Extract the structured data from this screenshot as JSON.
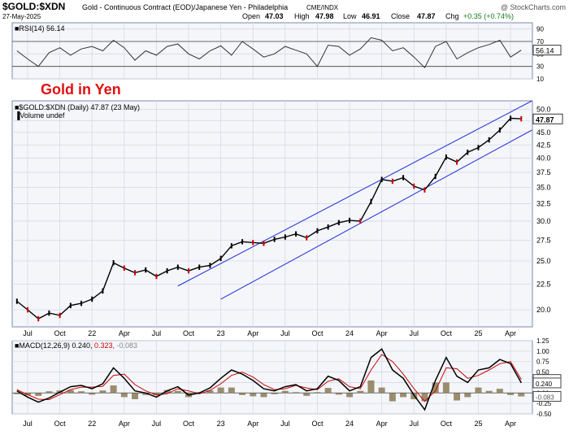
{
  "header": {
    "symbol": "$GOLD:$XDN",
    "description": "Gold - Continuous Contract (EOD)/Japanese Yen - Philadelphia",
    "exchange": "CME/INDX",
    "date": "27-May-2025",
    "copyright": "@ StockCharts.com",
    "ohlc": {
      "open_label": "Open",
      "open": "47.03",
      "high_label": "High",
      "high": "47.98",
      "low_label": "Low",
      "low": "46.91",
      "close_label": "Close",
      "close": "47.87",
      "chg_label": "Chg",
      "chg": "+0.35 (+0.74%)"
    }
  },
  "annotation": "Gold in Yen",
  "colors": {
    "price_up": "#000000",
    "price_down": "#cc0000",
    "channel": "#1f2bd6",
    "macd": "#000000",
    "signal": "#cc0000",
    "histogram": "#8a7a55",
    "annotation": "#e01010",
    "grid": "#d4d9e4",
    "panel_bg": "#f4f6fa"
  },
  "chart_data": [
    {
      "type": "line",
      "panel": "rsi",
      "label": "RSI(14)",
      "last_value": "56.14",
      "ylim": [
        10,
        100
      ],
      "y_ticks": [
        "90",
        "70",
        "50",
        "30",
        "10"
      ],
      "reference_lines": [
        70,
        30
      ],
      "x": [
        "2021-06",
        "2021-07",
        "2021-08",
        "2021-09",
        "2021-10",
        "2021-11",
        "2021-12",
        "2022-01",
        "2022-02",
        "2022-03",
        "2022-04",
        "2022-05",
        "2022-06",
        "2022-07",
        "2022-08",
        "2022-09",
        "2022-10",
        "2022-11",
        "2022-12",
        "2023-01",
        "2023-02",
        "2023-03",
        "2023-04",
        "2023-05",
        "2023-06",
        "2023-07",
        "2023-08",
        "2023-09",
        "2023-10",
        "2023-11",
        "2023-12",
        "2024-01",
        "2024-02",
        "2024-03",
        "2024-04",
        "2024-05",
        "2024-06",
        "2024-07",
        "2024-08",
        "2024-09",
        "2024-10",
        "2024-11",
        "2024-12",
        "2025-01",
        "2025-02",
        "2025-03",
        "2025-04",
        "2025-05"
      ],
      "values": [
        55,
        42,
        30,
        52,
        60,
        48,
        58,
        62,
        55,
        72,
        60,
        40,
        55,
        48,
        62,
        66,
        50,
        42,
        55,
        63,
        48,
        70,
        58,
        45,
        50,
        62,
        56,
        50,
        30,
        64,
        62,
        48,
        58,
        76,
        72,
        55,
        60,
        45,
        28,
        62,
        70,
        42,
        52,
        60,
        65,
        72,
        45,
        56
      ]
    },
    {
      "type": "line",
      "panel": "price",
      "label": "$GOLD:$XDN (Daily) 47.87 (23 May)",
      "volume_label": "Volume undef",
      "last_value": "47.87",
      "scale": "log",
      "ylim": [
        18.5,
        52
      ],
      "y_ticks": [
        "50.0",
        "47.5",
        "45.0",
        "42.5",
        "40.0",
        "37.5",
        "35.0",
        "32.5",
        "30.0",
        "27.5",
        "25.0",
        "22.5",
        "20.0"
      ],
      "x_ticks": [
        "Jul",
        "Oct",
        "22",
        "Apr",
        "Jul",
        "Oct",
        "23",
        "Apr",
        "Jul",
        "Oct",
        "24",
        "Apr",
        "Jul",
        "Oct",
        "25",
        "Apr"
      ],
      "x": [
        "2021-06",
        "2021-07",
        "2021-08",
        "2021-09",
        "2021-10",
        "2021-11",
        "2021-12",
        "2022-01",
        "2022-02",
        "2022-03",
        "2022-04",
        "2022-05",
        "2022-06",
        "2022-07",
        "2022-08",
        "2022-09",
        "2022-10",
        "2022-11",
        "2022-12",
        "2023-01",
        "2023-02",
        "2023-03",
        "2023-04",
        "2023-05",
        "2023-06",
        "2023-07",
        "2023-08",
        "2023-09",
        "2023-10",
        "2023-11",
        "2023-12",
        "2024-01",
        "2024-02",
        "2024-03",
        "2024-04",
        "2024-05",
        "2024-06",
        "2024-07",
        "2024-08",
        "2024-09",
        "2024-10",
        "2024-11",
        "2024-12",
        "2025-01",
        "2025-02",
        "2025-03",
        "2025-04",
        "2025-05"
      ],
      "values": [
        20.8,
        20.0,
        19.2,
        19.7,
        19.5,
        20.4,
        20.6,
        21.0,
        21.8,
        24.8,
        24.2,
        23.7,
        24.0,
        23.3,
        23.9,
        24.3,
        23.9,
        24.3,
        24.5,
        25.3,
        26.8,
        27.3,
        27.2,
        27.1,
        27.6,
        27.9,
        28.3,
        27.8,
        28.7,
        29.2,
        29.8,
        30.1,
        30.0,
        32.8,
        36.3,
        36.0,
        36.6,
        35.2,
        34.6,
        36.8,
        40.2,
        39.3,
        41.1,
        42.0,
        43.5,
        45.5,
        48.0,
        47.9
      ],
      "channel": {
        "upper": {
          "from": [
            "2022-09",
            22.3
          ],
          "to": [
            "2025-06",
            52.0
          ]
        },
        "lower": {
          "from": [
            "2023-01",
            21.0
          ],
          "to": [
            "2025-06",
            45.5
          ]
        }
      }
    },
    {
      "type": "line",
      "panel": "macd",
      "label": "MACD(12,26,9)",
      "macd_value": "0.240",
      "signal_value": "0.323",
      "hist_value": "-0.083",
      "ylim": [
        -0.5,
        1.25
      ],
      "y_ticks": [
        "1.25",
        "1.00",
        "0.75",
        "0.50",
        "0.25",
        "0.00",
        "-0.25",
        "-0.50"
      ],
      "x_ticks": [
        "Jul",
        "Oct",
        "22",
        "Apr",
        "Jul",
        "Oct",
        "23",
        "Apr",
        "Jul",
        "Oct",
        "24",
        "Apr",
        "Jul",
        "Oct",
        "25",
        "Apr"
      ],
      "x": [
        "2021-06",
        "2021-07",
        "2021-08",
        "2021-09",
        "2021-10",
        "2021-11",
        "2021-12",
        "2022-01",
        "2022-02",
        "2022-03",
        "2022-04",
        "2022-05",
        "2022-06",
        "2022-07",
        "2022-08",
        "2022-09",
        "2022-10",
        "2022-11",
        "2022-12",
        "2023-01",
        "2023-02",
        "2023-03",
        "2023-04",
        "2023-05",
        "2023-06",
        "2023-07",
        "2023-08",
        "2023-09",
        "2023-10",
        "2023-11",
        "2023-12",
        "2024-01",
        "2024-02",
        "2024-03",
        "2024-04",
        "2024-05",
        "2024-06",
        "2024-07",
        "2024-08",
        "2024-09",
        "2024-10",
        "2024-11",
        "2024-12",
        "2025-01",
        "2025-02",
        "2025-03",
        "2025-04",
        "2025-05"
      ],
      "series": [
        {
          "name": "MACD",
          "values": [
            0.05,
            -0.1,
            -0.22,
            -0.12,
            0.02,
            0.15,
            0.18,
            0.1,
            0.22,
            0.6,
            0.35,
            0.05,
            0.0,
            -0.1,
            0.05,
            0.15,
            -0.05,
            0.0,
            0.12,
            0.35,
            0.55,
            0.45,
            0.3,
            0.1,
            0.05,
            0.15,
            0.2,
            0.05,
            0.1,
            0.4,
            0.3,
            0.05,
            0.15,
            0.85,
            1.05,
            0.55,
            0.35,
            -0.05,
            -0.4,
            0.3,
            0.85,
            0.4,
            0.25,
            0.55,
            0.6,
            0.8,
            0.7,
            0.24
          ]
        },
        {
          "name": "Signal",
          "values": [
            0.08,
            -0.04,
            -0.15,
            -0.16,
            -0.04,
            0.08,
            0.14,
            0.14,
            0.16,
            0.42,
            0.45,
            0.2,
            0.05,
            -0.05,
            -0.02,
            0.1,
            0.05,
            -0.02,
            0.06,
            0.22,
            0.42,
            0.5,
            0.38,
            0.2,
            0.08,
            0.1,
            0.18,
            0.12,
            0.08,
            0.28,
            0.34,
            0.15,
            0.1,
            0.55,
            0.92,
            0.75,
            0.45,
            0.1,
            -0.2,
            0.05,
            0.6,
            0.58,
            0.35,
            0.42,
            0.55,
            0.7,
            0.75,
            0.323
          ]
        }
      ]
    }
  ]
}
